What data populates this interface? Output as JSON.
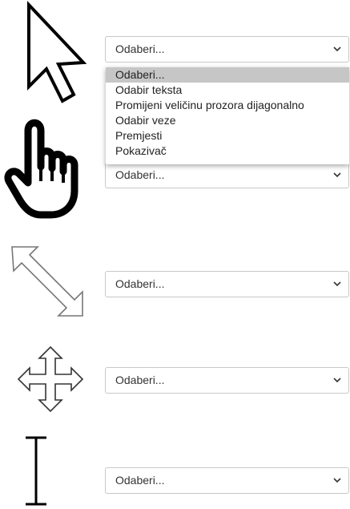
{
  "rows": [
    {
      "icon": "arrow-pointer-icon",
      "select_value": "Odaberi..."
    },
    {
      "icon": "hand-pointer-icon",
      "select_value": "Odaberi..."
    },
    {
      "icon": "diagonal-resize-icon",
      "select_value": "Odaberi..."
    },
    {
      "icon": "move-icon",
      "select_value": "Odaberi..."
    },
    {
      "icon": "text-ibeam-icon",
      "select_value": "Odaberi..."
    }
  ],
  "dropdown": {
    "options": [
      "Odaberi...",
      "Odabir teksta",
      "Promijeni veličinu prozora dijagonalno",
      "Odabir veze",
      "Premjesti",
      "Pokazivač"
    ],
    "highlighted": 0
  }
}
